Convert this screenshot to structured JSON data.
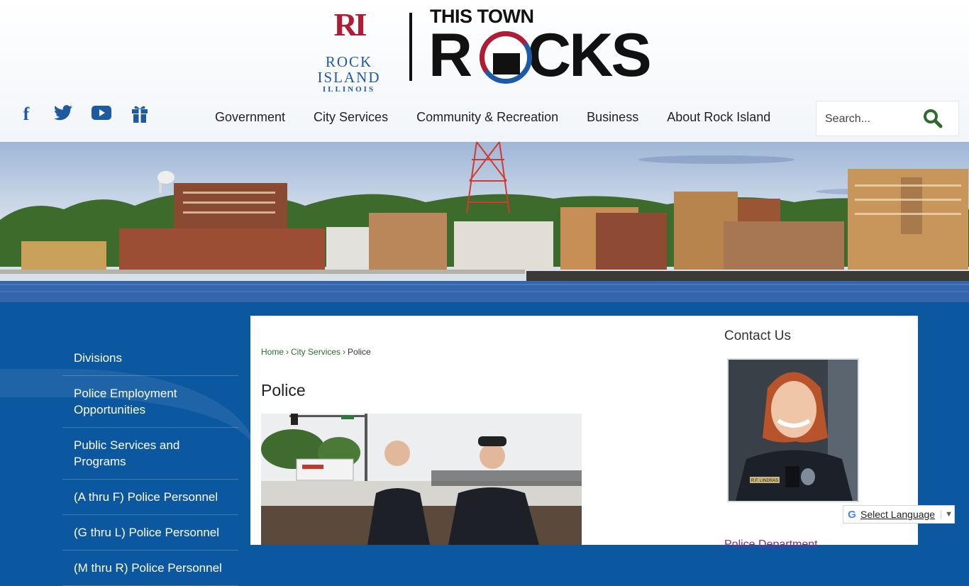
{
  "header": {
    "logo": {
      "mark": "RI",
      "name": "ROCK ISLAND",
      "state": "ILLINOIS"
    },
    "tagline_top": "THIS TOWN",
    "tagline_big_start": "R",
    "tagline_big_end": "CKS"
  },
  "social": [
    {
      "icon": "facebook-icon"
    },
    {
      "icon": "twitter-icon"
    },
    {
      "icon": "youtube-icon"
    },
    {
      "icon": "gift-icon"
    }
  ],
  "nav": {
    "items": [
      "Government",
      "City Services",
      "Community & Recreation",
      "Business",
      "About Rock Island"
    ]
  },
  "search": {
    "placeholder": "Search..."
  },
  "sidenav": {
    "items": [
      "Divisions",
      "Police Employment Opportunities",
      "Public Services and Programs",
      "(A thru F) Police Personnel",
      "(G thru L) Police Personnel",
      "(M thru R) Police Personnel"
    ]
  },
  "breadcrumb": {
    "home": "Home",
    "section": "City Services",
    "current": "Police",
    "separator": "›"
  },
  "page": {
    "title": "Police"
  },
  "contact": {
    "title": "Contact Us",
    "link": "Police Department"
  },
  "officer_photo": {
    "name_tag": "R.F. LINDRAS"
  },
  "translate": {
    "g": "G",
    "label": "Select Language",
    "arrow": "▼"
  },
  "colors": {
    "brand_blue": "#0b57a0",
    "logo_red": "#b01c33",
    "breadcrumb_green": "#2a6f2a",
    "link_purple": "#7a2c8a"
  }
}
